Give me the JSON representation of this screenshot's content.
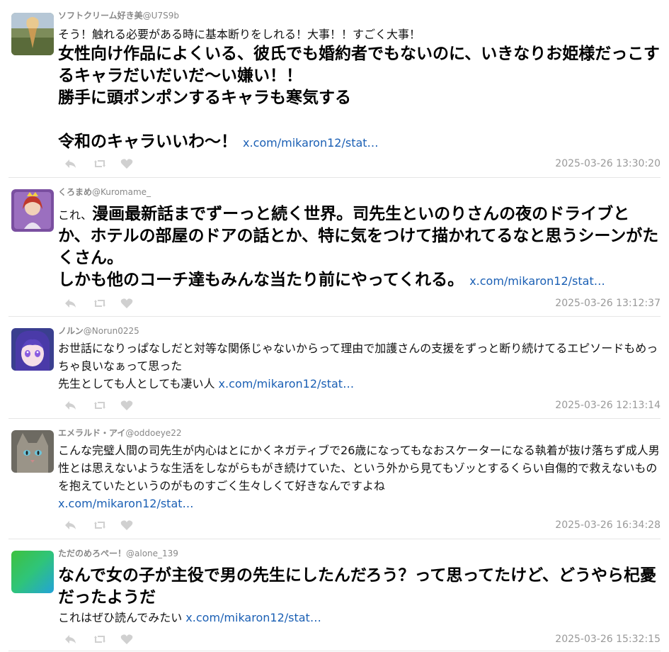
{
  "posts": [
    {
      "name": "ソフトクリーム好き美",
      "handle": "@U7S9b",
      "lines": [
        {
          "size": "small",
          "text": "そう！触れる必要がある時に基本断りをしれる！大事！！すごく大事！"
        },
        {
          "size": "big",
          "text": "女性向け作品によくいる、彼氏でも婚約者でもないのに、いきなりお姫様だっこするキャラだいだいだ〜い嫌い！！\n勝手に頭ポンポンするキャラも寒気する\n\n令和のキャラいいわ〜！"
        }
      ],
      "link": "x.com/mikaron12/stat…",
      "time": "2025-03-26 13:30:20"
    },
    {
      "name": "くろまめ",
      "handle": "@Kuromame_",
      "lines": [
        {
          "size": "mixed",
          "prefix": "これ、",
          "text": "漫画最新話までずーっと続く世界。司先生といのりさんの夜のドライブとか、ホテルの部屋のドアの話とか、特に気をつけて描かれてるなと思うシーンがたくさん。\nしかも他のコーチ達もみんな当たり前にやってくれる。"
        }
      ],
      "link": "x.com/mikaron12/stat…",
      "time": "2025-03-26 13:12:37"
    },
    {
      "name": "ノルン",
      "handle": "@Norun0225",
      "lines": [
        {
          "size": "small",
          "text": "お世話になりっぱなしだと対等な関係じゃないからって理由で加護さんの支援をずっと断り続けてるエピソードもめっちゃ良いなぁって思った\n先生としても人としても凄い人"
        }
      ],
      "link": "x.com/mikaron12/stat…",
      "time": "2025-03-26 12:13:14"
    },
    {
      "name": "エメラルド・アイ",
      "handle": "@oddoeye22",
      "lines": [
        {
          "size": "small",
          "text": "こんな完璧人間の司先生が内心はとにかくネガティブで26歳になってもなおスケーターになる執着が抜け落ちず成人男性とは思えないような生活をしながらもがき続けていた、という外から見てもゾッとするくらい自傷的で救えないものを抱えていたというのがものすごく生々しくて好きなんですよね\n"
        }
      ],
      "link": "x.com/mikaron12/stat…",
      "time": "2025-03-26 16:34:28"
    },
    {
      "name": "ただのめろぺー！",
      "handle": "@alone_139",
      "lines": [
        {
          "size": "big",
          "text": "なんで女の子が主役で男の先生にしたんだろう？って思ってたけど、どうやら杞憂だったようだ"
        },
        {
          "size": "small",
          "text": "これはぜひ読んでみたい"
        }
      ],
      "link": "x.com/mikaron12/stat…",
      "time": "2025-03-26 15:32:15"
    }
  ],
  "icons": {
    "reply": "reply-arrow-icon",
    "repost": "repost-arrows-icon",
    "like": "heart-icon"
  },
  "colors": {
    "link": "#1a5fb4",
    "meta": "#999999",
    "action_icon": "#d0d0d0"
  }
}
